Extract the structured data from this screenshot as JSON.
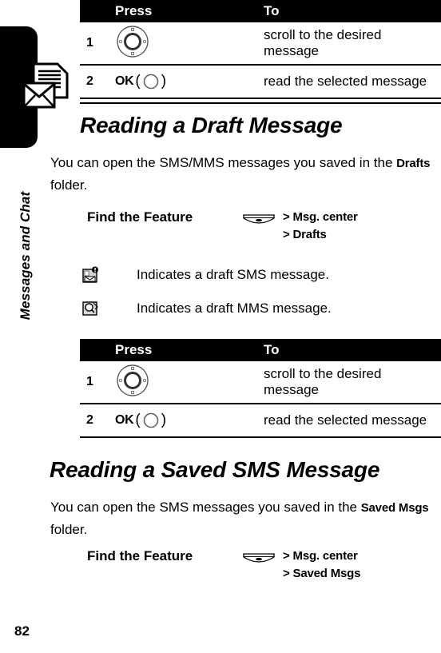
{
  "chapter": {
    "label": "Messages and Chat",
    "icon": "envelope-document-icon"
  },
  "page_number": "82",
  "table_top": {
    "headers": {
      "num": "",
      "press": "Press",
      "to": "To"
    },
    "rows": [
      {
        "num": "1",
        "press_icon": "navigation-wheel-icon",
        "press_label": "",
        "to": "scroll to the desired message"
      },
      {
        "num": "2",
        "press_icon": "ok-key-icon",
        "press_label": "OK",
        "to": "read the selected message"
      }
    ]
  },
  "section_draft": {
    "heading": "Reading a Draft Message",
    "intro_before": "You can open the SMS/MMS messages you saved in the ",
    "intro_keyword": "Drafts",
    "intro_after": " folder.",
    "find_feature": {
      "label": "Find the Feature",
      "menu_icon": "menu-key-icon",
      "path": [
        {
          "sep": ">",
          "item": "Msg. center"
        },
        {
          "sep": ">",
          "item": "Drafts"
        }
      ]
    },
    "indicators": [
      {
        "icon": "draft-sms-icon",
        "text": "Indicates a draft SMS message."
      },
      {
        "icon": "draft-mms-icon",
        "text": "Indicates a draft MMS message."
      }
    ]
  },
  "table_draft": {
    "headers": {
      "num": "",
      "press": "Press",
      "to": "To"
    },
    "rows": [
      {
        "num": "1",
        "press_icon": "navigation-wheel-icon",
        "press_label": "",
        "to": "scroll to the desired message"
      },
      {
        "num": "2",
        "press_icon": "ok-key-icon",
        "press_label": "OK",
        "to": "read the selected message"
      }
    ]
  },
  "section_saved": {
    "heading": "Reading a Saved SMS Message",
    "intro_before": "You can open the SMS messages you saved in the ",
    "intro_keyword": "Saved Msgs",
    "intro_after": " folder.",
    "find_feature": {
      "label": "Find the Feature",
      "menu_icon": "menu-key-icon",
      "path": [
        {
          "sep": ">",
          "item": "Msg. center"
        },
        {
          "sep": ">",
          "item": "Saved Msgs"
        }
      ]
    }
  },
  "colors": {
    "header_bar": "#000000",
    "header_text": "#ffffff",
    "page_bg": "#ffffff",
    "body_text": "#000000"
  }
}
